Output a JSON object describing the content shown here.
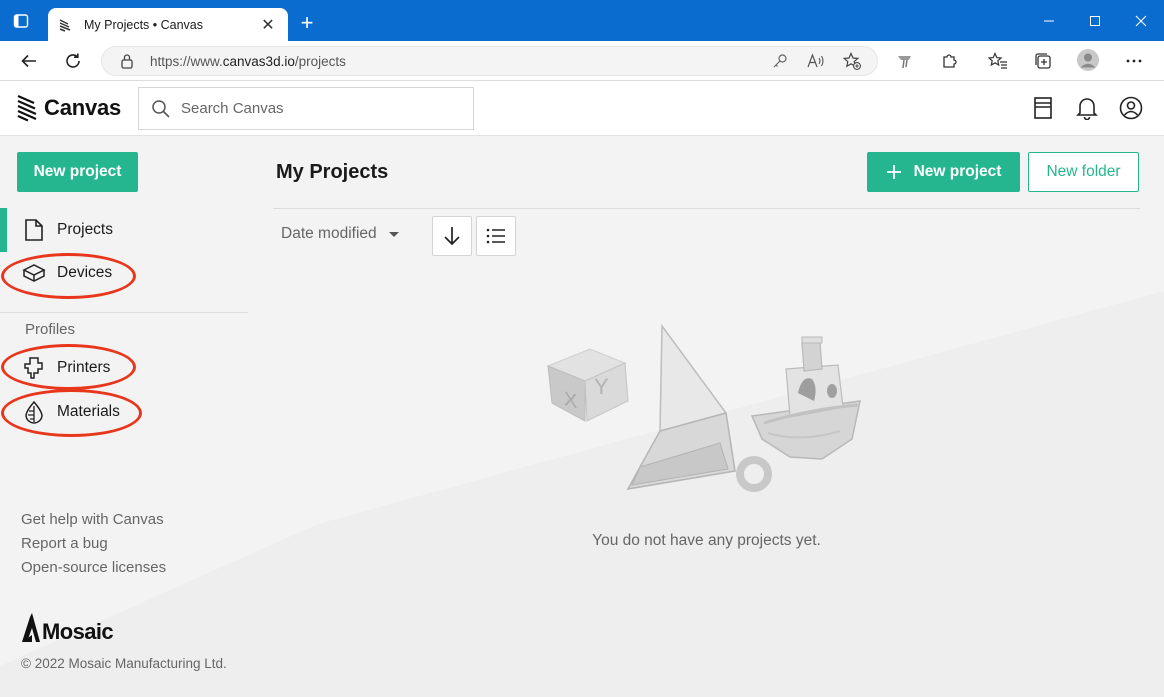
{
  "browser": {
    "tab_title": "My Projects • Canvas",
    "url_prefix": "https://www.",
    "url_host": "canvas3d.io",
    "url_path": "/projects",
    "new_tab_glyph": "+"
  },
  "app": {
    "logo_text": "Canvas",
    "search_placeholder": "Search Canvas"
  },
  "sidebar": {
    "new_project_label": "New project",
    "items": [
      {
        "label": "Projects",
        "icon": "document-icon",
        "active": true
      },
      {
        "label": "Devices",
        "icon": "box-icon"
      }
    ],
    "profiles_label": "Profiles",
    "profile_items": [
      {
        "label": "Printers",
        "icon": "printer-head-icon"
      },
      {
        "label": "Materials",
        "icon": "filament-spool-icon"
      }
    ],
    "footer_links": [
      "Get help with Canvas",
      "Report a bug",
      "Open-source licenses"
    ],
    "brand": "Mosaic",
    "copyright": "© 2022 Mosaic Manufacturing Ltd."
  },
  "main": {
    "title": "My Projects",
    "new_project_label": "New project",
    "new_folder_label": "New folder",
    "sort_label": "Date modified",
    "empty_message": "You do not have any projects yet."
  },
  "colors": {
    "accent": "#26b68f",
    "browser_blue": "#0a6ccf",
    "annotation_red": "#e8361c"
  }
}
